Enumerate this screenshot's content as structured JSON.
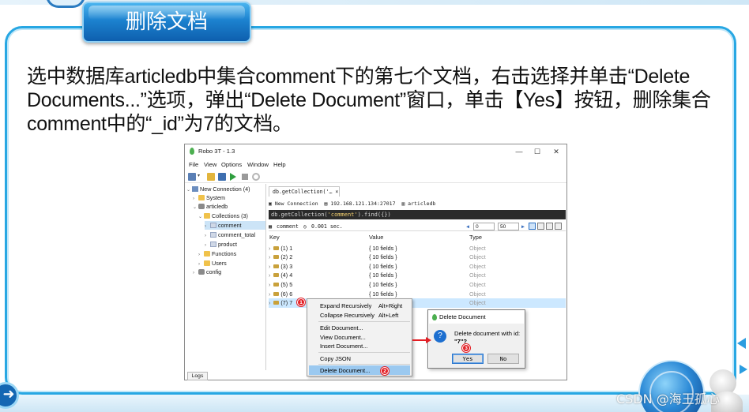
{
  "slide": {
    "title": "删除文档",
    "intro_text": "选中数据库articledb中集合comment下的第七个文档，右击选择并单击“Delete Documents...”选项，弹出“Delete Document”窗口，单击【Yes】按钮，删除集合comment中的“_id”为7的文档。",
    "watermark": "CSDN @海王孤心"
  },
  "colors": {
    "accent": "#27a7e3",
    "title_tab": "#1c82cf",
    "marker": "#e31e24",
    "highlight": "#cce8ff"
  },
  "window": {
    "title": "Robo 3T - 1.3",
    "controls": [
      "—",
      "☐",
      "✕"
    ],
    "menu": [
      "File",
      "View",
      "Options",
      "Window",
      "Help"
    ]
  },
  "tree": {
    "server": "New Connection (4)",
    "system": "System",
    "db": "articledb",
    "collections": "Collections (3)",
    "coll_items": [
      "comment",
      "comment_total",
      "product"
    ],
    "functions": "Functions",
    "users": "Users",
    "config": "config",
    "logs_tab": "Logs"
  },
  "panel": {
    "tab_label": "db.getCollection('…",
    "crumb_conn": "New Connection",
    "crumb_host": "192.168.121.134:27017",
    "crumb_db": "articledb",
    "query_prefix": "db.getCollection(",
    "query_string": "'comment'",
    "query_suffix": ").find({})",
    "collection": "comment",
    "elapsed": "0.001 sec.",
    "page_from": "0",
    "page_size": "50",
    "headers": {
      "key": "Key",
      "value": "Value",
      "type": "Type"
    },
    "rows": [
      {
        "key": "(1) 1",
        "value": "{ 10 fields }",
        "type": "Object"
      },
      {
        "key": "(2) 2",
        "value": "{ 10 fields }",
        "type": "Object"
      },
      {
        "key": "(3) 3",
        "value": "{ 10 fields }",
        "type": "Object"
      },
      {
        "key": "(4) 4",
        "value": "{ 10 fields }",
        "type": "Object"
      },
      {
        "key": "(5) 5",
        "value": "{ 10 fields }",
        "type": "Object"
      },
      {
        "key": "(6) 6",
        "value": "{ 10 fields }",
        "type": "Object"
      },
      {
        "key": "(7) 7",
        "value": "",
        "type": "Object"
      }
    ]
  },
  "context_menu": {
    "expand": "Expand Recursively",
    "expand_shortcut": "Alt+Right",
    "collapse": "Collapse Recursively",
    "collapse_shortcut": "Alt+Left",
    "edit": "Edit Document...",
    "view": "View Document...",
    "insert": "Insert Document...",
    "copy_json": "Copy JSON",
    "delete": "Delete Document..."
  },
  "dialog": {
    "title": "Delete Document",
    "message": "Delete document with id:",
    "id_value": "\"7\"?",
    "yes": "Yes",
    "no": "No"
  },
  "markers": [
    "1",
    "2",
    "3"
  ]
}
